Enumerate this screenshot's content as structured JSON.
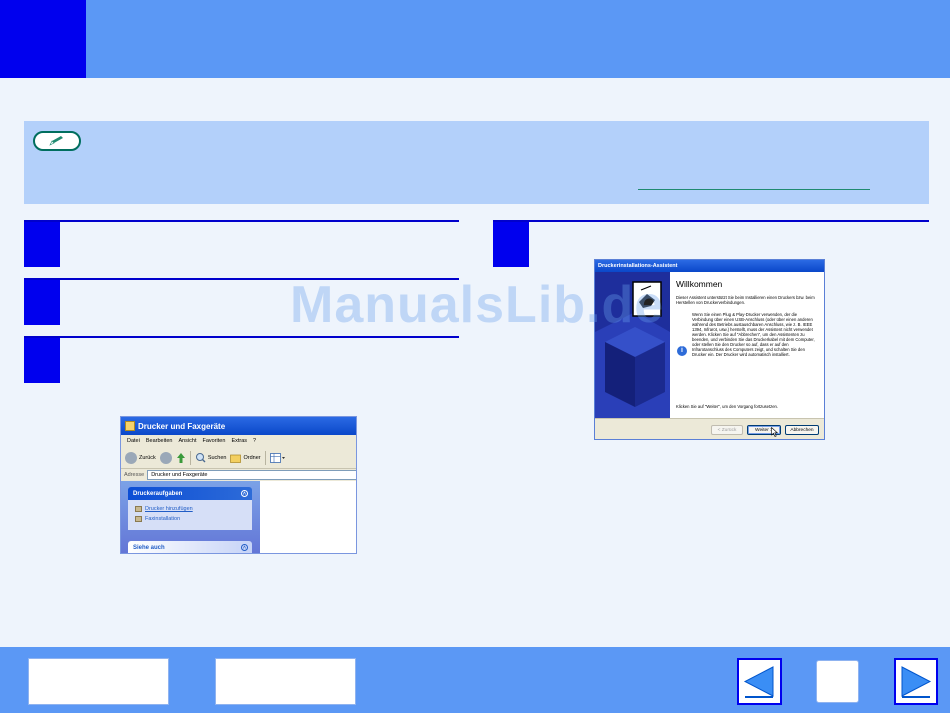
{
  "explorer": {
    "title": "Drucker und Faxgeräte",
    "menu": [
      "Datei",
      "Bearbeiten",
      "Ansicht",
      "Favoriten",
      "Extras",
      "?"
    ],
    "toolbar": {
      "back": "Zurück",
      "search": "Suchen",
      "folders": "Ordner"
    },
    "address_label": "Adresse",
    "address_value": "Drucker und Faxgeräte",
    "tasks_header": "Druckeraufgaben",
    "tasks": [
      "Drucker hinzufügen",
      "Faxinstallation"
    ],
    "see_also_header": "Siehe auch"
  },
  "wizard": {
    "title": "Druckerinstallations-Assistent",
    "heading": "Willkommen",
    "intro": "Dieser Assistent unterstützt Sie beim Installieren einen Druckers bzw. beim Herstellen von Druckerverbindungen.",
    "info": "Wenn Sie einen Plug & Play-Drucker verwenden, der die Verbindung über einen USB-Anschluss (oder über einen anderen während des Betriebs austauschbaren Anschluss, wie z. B. IEEE 1394, Infrarot, usw.) herstellt, muss der Assistent nicht verwendet werden. Klicken Sie auf \"Abbrechen\", um den Assistenten zu beenden, und verbinden Sie das Druckerkabel mit dem Computer, oder stellen Sie den Drucker so auf, dass er auf den Infrarotanschluss des Computers zeigt, und schalten Sie den Drucker ein. Der Drucker wird automatisch installiert.",
    "continue_hint": "Klicken Sie auf \"Weiter\", um den Vorgang fortzusetzen.",
    "buttons": {
      "back": "< Zurück",
      "next": "Weiter >",
      "cancel": "Abbrechen"
    }
  },
  "watermark": "ManualsLib.de"
}
